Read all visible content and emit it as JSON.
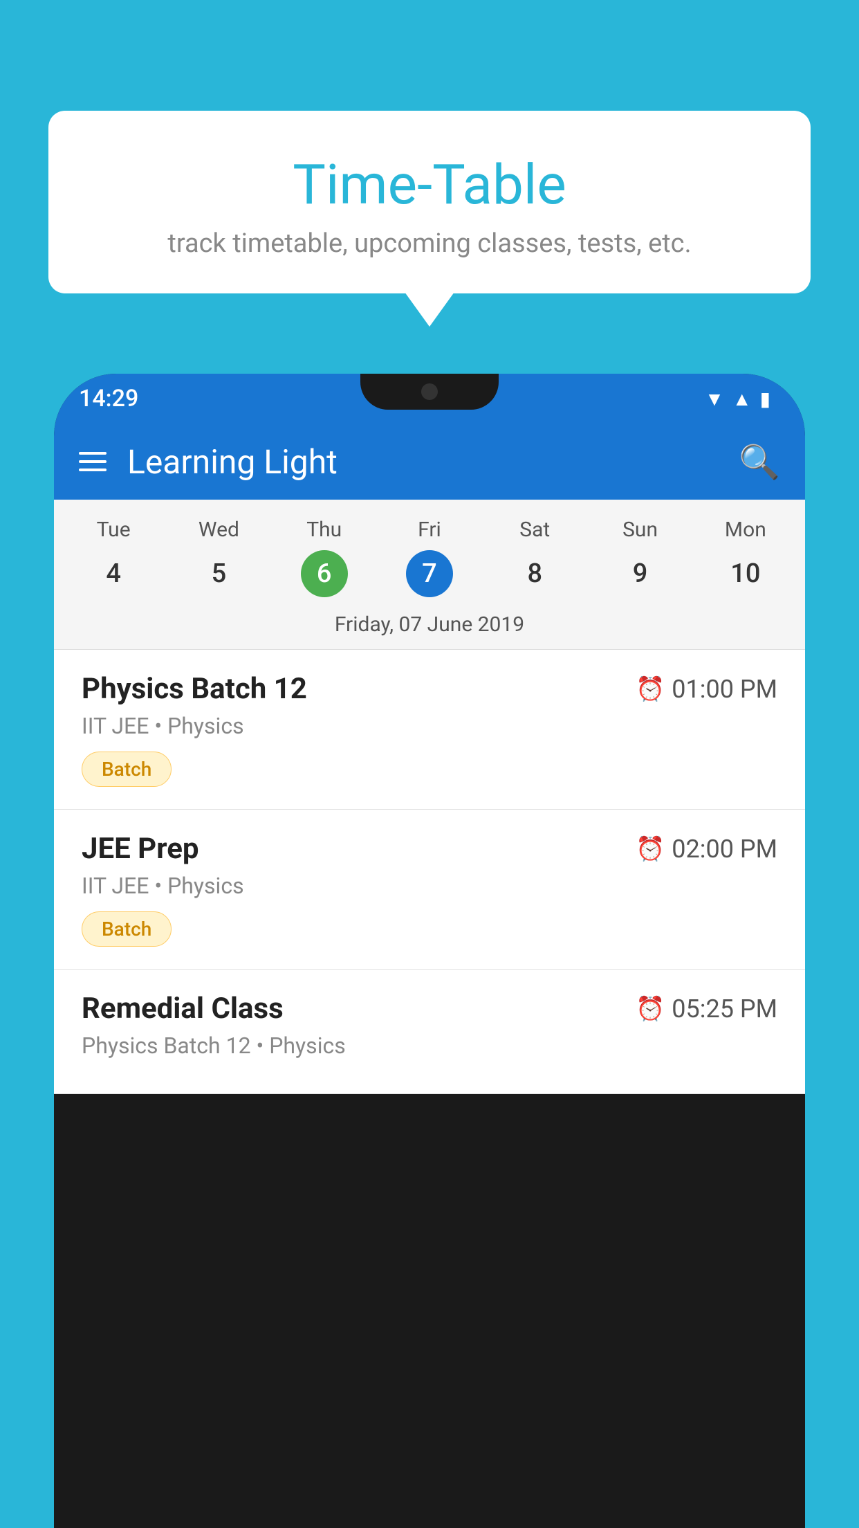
{
  "background_color": "#29B6D8",
  "bubble": {
    "title": "Time-Table",
    "subtitle": "track timetable, upcoming classes, tests, etc."
  },
  "status_bar": {
    "time": "14:29"
  },
  "app_bar": {
    "title": "Learning Light"
  },
  "calendar": {
    "days": [
      "Tue",
      "Wed",
      "Thu",
      "Fri",
      "Sat",
      "Sun",
      "Mon"
    ],
    "dates": [
      "4",
      "5",
      "6",
      "7",
      "8",
      "9",
      "10"
    ],
    "today_index": 2,
    "selected_index": 3,
    "selected_label": "Friday, 07 June 2019"
  },
  "schedule": [
    {
      "title": "Physics Batch 12",
      "time": "01:00 PM",
      "subtitle": "IIT JEE • Physics",
      "tag": "Batch"
    },
    {
      "title": "JEE Prep",
      "time": "02:00 PM",
      "subtitle": "IIT JEE • Physics",
      "tag": "Batch"
    },
    {
      "title": "Remedial Class",
      "time": "05:25 PM",
      "subtitle": "Physics Batch 12 • Physics",
      "tag": null
    }
  ]
}
